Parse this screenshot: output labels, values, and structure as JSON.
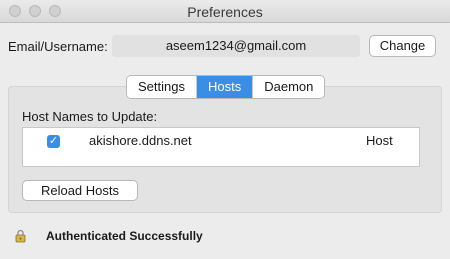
{
  "window": {
    "title": "Preferences"
  },
  "account": {
    "email_label": "Email/Username:",
    "email_value": "aseem1234@gmail.com",
    "change_label": "Change"
  },
  "tabs": [
    {
      "label": "Settings",
      "active": false
    },
    {
      "label": "Hosts",
      "active": true
    },
    {
      "label": "Daemon",
      "active": false
    }
  ],
  "hosts": {
    "section_label": "Host Names to Update:",
    "items": [
      {
        "name": "akishore.ddns.net",
        "type": "Host",
        "checked": true
      }
    ],
    "reload_label": "Reload Hosts"
  },
  "status": {
    "text": "Authenticated Successfully",
    "icon": "lock-icon"
  },
  "colors": {
    "accent": "#3a8ee6"
  }
}
